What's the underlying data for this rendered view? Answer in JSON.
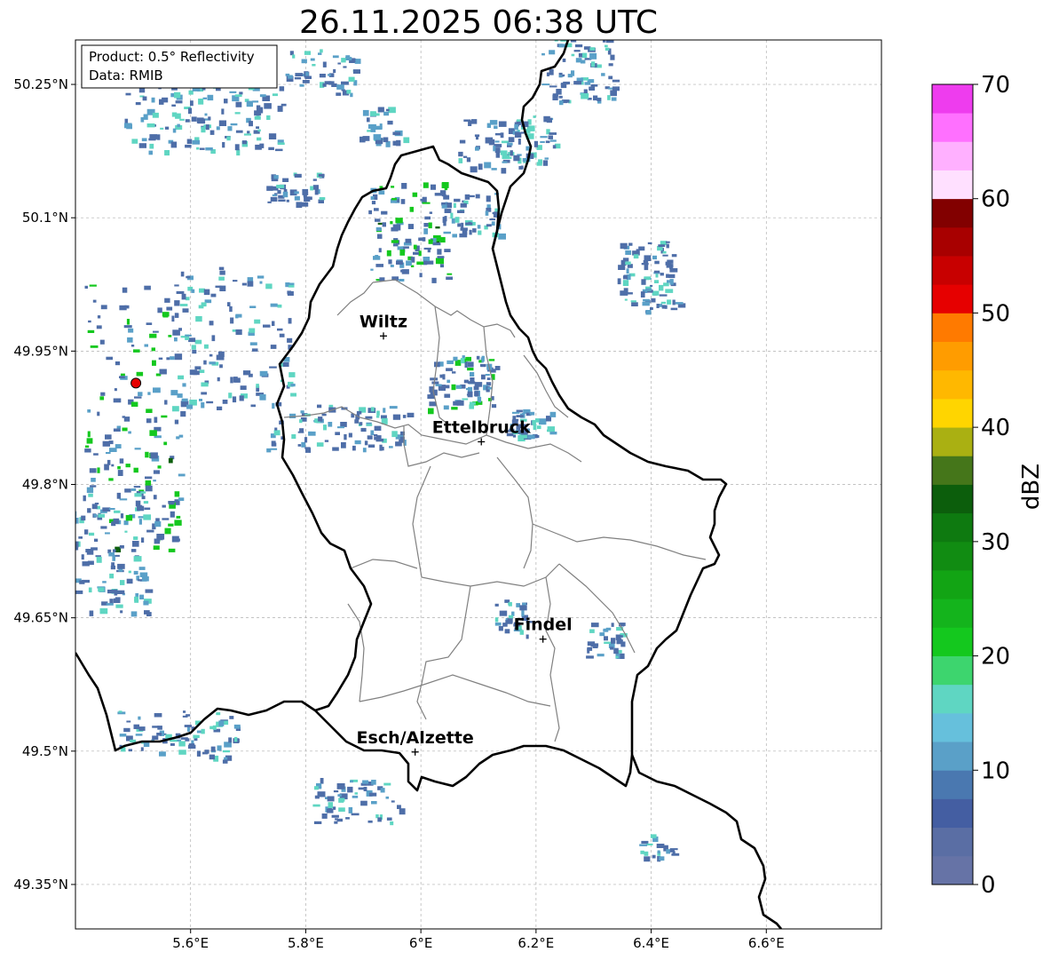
{
  "title": "26.11.2025 06:38 UTC",
  "info_box": {
    "line1": "Product: 0.5° Reflectivity",
    "line2": "Data: RMIB"
  },
  "map": {
    "lon_range": [
      5.4,
      6.8
    ],
    "lat_range": [
      49.3,
      50.3
    ],
    "lon_ticks": [
      {
        "value": 5.6,
        "label": "5.6°E"
      },
      {
        "value": 5.8,
        "label": "5.8°E"
      },
      {
        "value": 6.0,
        "label": "6°E"
      },
      {
        "value": 6.2,
        "label": "6.2°E"
      },
      {
        "value": 6.4,
        "label": "6.4°E"
      },
      {
        "value": 6.6,
        "label": "6.6°E"
      }
    ],
    "lat_ticks": [
      {
        "value": 50.25,
        "label": "50.25°N"
      },
      {
        "value": 50.1,
        "label": "50.1°N"
      },
      {
        "value": 49.95,
        "label": "49.95°N"
      },
      {
        "value": 49.8,
        "label": "49.8°N"
      },
      {
        "value": 49.65,
        "label": "49.65°N"
      },
      {
        "value": 49.5,
        "label": "49.5°N"
      },
      {
        "value": 49.35,
        "label": "49.35°N"
      }
    ],
    "gridlines": true,
    "radar_site": {
      "lon": 5.505,
      "lat": 49.914
    },
    "cities": [
      {
        "name": "Wiltz",
        "lon": 5.935,
        "lat": 49.967
      },
      {
        "name": "Ettelbruck",
        "lon": 6.105,
        "lat": 49.848
      },
      {
        "name": "Findel",
        "lon": 6.212,
        "lat": 49.626
      },
      {
        "name": "Esch/Alzette",
        "lon": 5.99,
        "lat": 49.499
      }
    ]
  },
  "colorbar": {
    "label": "dBZ",
    "min": 0,
    "max": 70,
    "step": 2.5,
    "tick_labels": [
      "0",
      "10",
      "20",
      "30",
      "40",
      "50",
      "60",
      "70"
    ],
    "colors": [
      "#6673a6",
      "#5a6ea4",
      "#445ea2",
      "#4a78b0",
      "#5aa0c8",
      "#66c0dc",
      "#5fd6c2",
      "#3dd56e",
      "#14c81e",
      "#14b41c",
      "#12a414",
      "#118c12",
      "#0e7a10",
      "#0c5e0c",
      "#45761a",
      "#aab012",
      "#ffd500",
      "#ffb800",
      "#ff9c00",
      "#ff7a00",
      "#e60000",
      "#c80000",
      "#a80000",
      "#820000",
      "#ffe0ff",
      "#ffb0ff",
      "#ff70ff",
      "#ee3cee"
    ]
  },
  "echo_colors": {
    "weak": "#4e6ea8",
    "moderate": "#5aa0c8",
    "cyan": "#5fd6c2",
    "green": "#14c81e",
    "darkgreen": "#0c5e0c",
    "red": "#e60000"
  }
}
